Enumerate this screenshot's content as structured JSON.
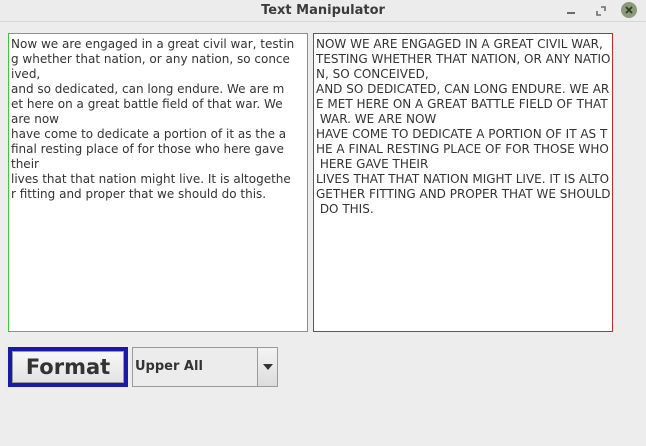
{
  "window": {
    "title": "Text Manipulator"
  },
  "input_text": "Now we are engaged in a great civil war, testin\ng whether that nation, or any nation, so conce\nived,\nand so dedicated, can long endure. We are m\net here on a great battle field of that war. We\nare now\nhave come to dedicate a portion of it as the a\nfinal resting place of for those who here gave\ntheir\nlives that that nation might live. It is altogethe\nr fitting and proper that we should do this.",
  "output_text": "NOW WE ARE ENGAGED IN A GREAT CIVIL WAR,\nTESTING WHETHER THAT NATION, OR ANY NATIO\nN, SO CONCEIVED,\nAND SO DEDICATED, CAN LONG ENDURE. WE AR\nE MET HERE ON A GREAT BATTLE FIELD OF THAT\n WAR. WE ARE NOW\nHAVE COME TO DEDICATE A PORTION OF IT AS T\nHE A FINAL RESTING PLACE OF FOR THOSE WHO\n HERE GAVE THEIR\nLIVES THAT THAT NATION MIGHT LIVE. IT IS ALTO\nGETHER FITTING AND PROPER THAT WE SHOULD\n DO THIS.",
  "controls": {
    "format_label": "Format",
    "mode_selected": "Upper All"
  },
  "colors": {
    "input_border": "#3ec83e",
    "output_border": "#c42b2b",
    "format_focus": "#1a1aa8"
  },
  "icons": {
    "minimize": "minimize-icon",
    "maximize": "maximize-icon",
    "close": "close-icon",
    "dropdown": "chevron-down-icon"
  }
}
